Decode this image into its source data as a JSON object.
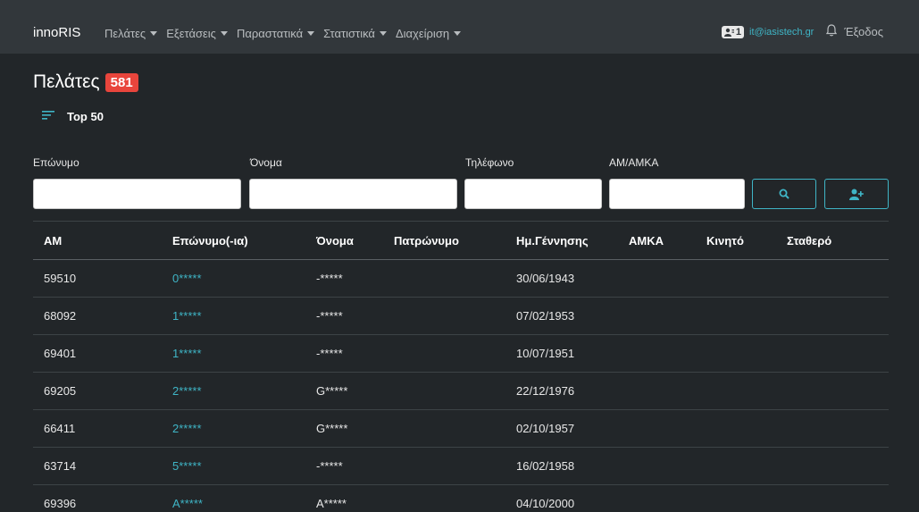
{
  "navbar": {
    "brand": "innoRIS",
    "menu": [
      {
        "label": "Πελάτες"
      },
      {
        "label": "Εξετάσεις"
      },
      {
        "label": "Παραστατικά"
      },
      {
        "label": "Στατιστικά"
      },
      {
        "label": "Διαχείριση"
      }
    ],
    "id_badge": "1",
    "user_email": "it@iasistech.gr",
    "logout": "Έξοδος"
  },
  "page": {
    "title": "Πελάτες",
    "count": "581",
    "filter_label": "Top 50"
  },
  "search": {
    "surname_label": "Επώνυμο",
    "name_label": "Όνομα",
    "phone_label": "Τηλέφωνο",
    "am_label": "ΑΜ/ΑΜΚΑ",
    "surname_value": "",
    "name_value": "",
    "phone_value": "",
    "am_value": ""
  },
  "table": {
    "headers": [
      "ΑΜ",
      "Επώνυμο(-ια)",
      "Όνομα",
      "Πατρώνυμο",
      "Ημ.Γέννησης",
      "ΑΜΚΑ",
      "Κινητό",
      "Σταθερό"
    ],
    "rows": [
      {
        "am": "59510",
        "surname": "0*****",
        "name": "-*****",
        "father": "",
        "dob": "30/06/1943",
        "amka": "",
        "mobile": "",
        "phone": ""
      },
      {
        "am": "68092",
        "surname": "1*****",
        "name": "-*****",
        "father": "",
        "dob": "07/02/1953",
        "amka": "",
        "mobile": "",
        "phone": ""
      },
      {
        "am": "69401",
        "surname": "1*****",
        "name": "-*****",
        "father": "",
        "dob": "10/07/1951",
        "amka": "",
        "mobile": "",
        "phone": ""
      },
      {
        "am": "69205",
        "surname": "2*****",
        "name": "G*****",
        "father": "",
        "dob": "22/12/1976",
        "amka": "",
        "mobile": "",
        "phone": ""
      },
      {
        "am": "66411",
        "surname": "2*****",
        "name": "G*****",
        "father": "",
        "dob": "02/10/1957",
        "amka": "",
        "mobile": "",
        "phone": ""
      },
      {
        "am": "63714",
        "surname": "5*****",
        "name": "-*****",
        "father": "",
        "dob": "16/02/1958",
        "amka": "",
        "mobile": "",
        "phone": ""
      },
      {
        "am": "69396",
        "surname": "A*****",
        "name": "A*****",
        "father": "",
        "dob": "04/10/2000",
        "amka": "",
        "mobile": "",
        "phone": ""
      }
    ]
  },
  "colors": {
    "background": "#222629",
    "navbar": "#32373b",
    "accent": "#3fb5c6",
    "badge": "#e8453c"
  },
  "icons": [
    "id-card-icon",
    "bell-icon",
    "sort-lines-icon",
    "search-icon",
    "add-user-icon",
    "caret-down-icon"
  ]
}
